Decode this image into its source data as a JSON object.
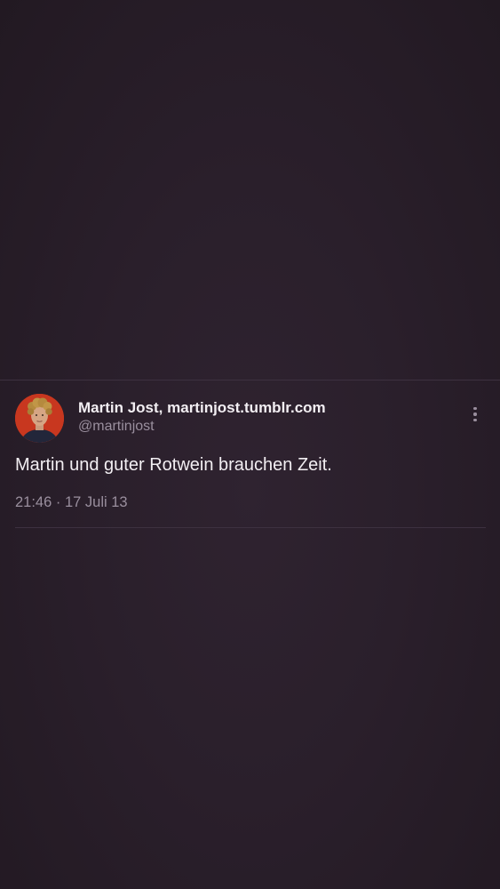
{
  "tweet": {
    "display_name": "Martin Jost, martinjost.tumblr.com",
    "handle": "@martinjost",
    "text": "Martin und guter Rotwein brauchen Zeit.",
    "time": "21:46",
    "separator": " · ",
    "date": "17 Juli 13",
    "more_icon": "more-vertical-icon",
    "avatar_background": "#c8371f"
  },
  "colors": {
    "background": "#2a1f2b",
    "primary_text": "#f2eef2",
    "secondary_text": "#9a8f9e",
    "divider": "#3d3140"
  }
}
